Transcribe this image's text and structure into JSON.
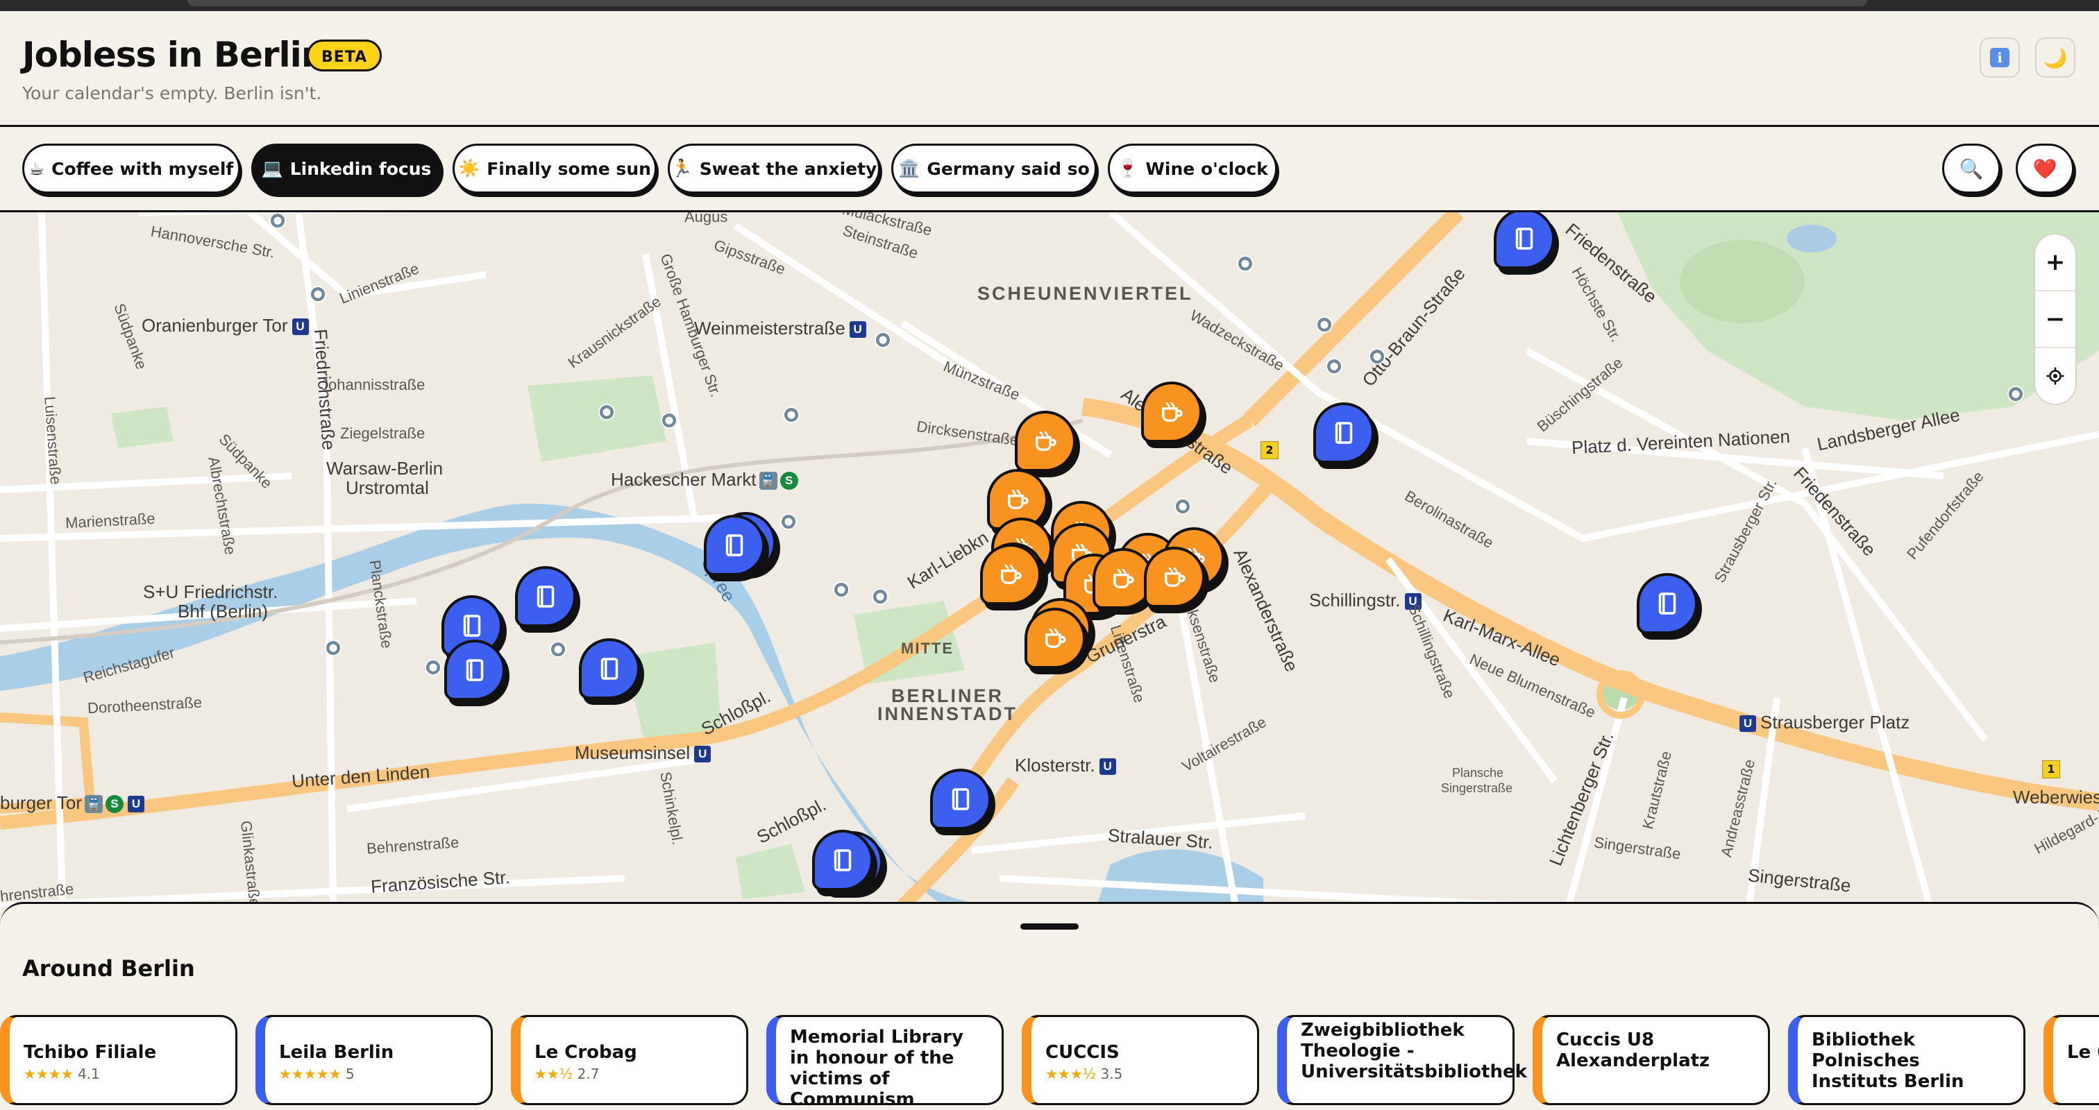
{
  "header": {
    "title": "Jobless in Berlin",
    "badge": "BETA",
    "subtitle": "Your calendar's empty. Berlin isn't.",
    "info_icon": "info-icon",
    "theme_icon": "moon-icon"
  },
  "filters": [
    {
      "icon": "☕",
      "label": "Coffee with myself",
      "active": false
    },
    {
      "icon": "💻",
      "label": "Linkedin focus",
      "active": true
    },
    {
      "icon": "☀️",
      "label": "Finally some sun",
      "active": false
    },
    {
      "icon": "🏃",
      "label": "Sweat the anxiety",
      "active": false
    },
    {
      "icon": "🏛️",
      "label": "Germany said so",
      "active": false
    },
    {
      "icon": "🍷",
      "label": "Wine o'clock",
      "active": false
    }
  ],
  "actions": {
    "search_icon": "search-icon",
    "favorites_icon": "heart-icon"
  },
  "map": {
    "labels": {
      "scheunenviertel": "SCHEUNENVIERTEL",
      "mitte": "MITTE",
      "berliner": "BERLINER",
      "innenstadt": "INNENSTADT",
      "warsaw1": "Warsaw-Berlin",
      "warsaw2": "Urstromtal",
      "oranienburger": "Oranienburger Tor",
      "weinmeister": "Weinmeisterstraße",
      "hackescher": "Hackescher Markt",
      "friedrichbhf1": "S+U Friedrichstr.",
      "friedrichbhf2": "Bhf (Berlin)",
      "museumsinsel": "Museumsinsel",
      "klosterstr": "Klosterstr.",
      "schillingstr": "Schillingstr.",
      "strausberger": "Strausberger Platz",
      "brandenburger": "burger Tor",
      "platz_vn": "Platz d. Vereinten Nationen",
      "landsberger": "Landsberger Allee",
      "unter_den_linden": "Unter den Linden",
      "franzoesische": "Französische Str.",
      "behrenstrasse": "Behrenstraße",
      "stralauer": "Stralauer Str.",
      "singerstrasse1": "Singerstraße",
      "singerstrasse2": "Singerstraße",
      "weberwiese": "Weberwiese",
      "hildegard": "Hildegard-J",
      "johannis": "Johannisstraße",
      "ziegel": "Ziegelstraße",
      "marien": "Marienstraße",
      "dorotheen": "Dorotheenstraße",
      "reichstagufer": "Reichstagufer",
      "hannoversche": "Hannoversche Str.",
      "linien": "Linienstraße",
      "gips": "Gipsstraße",
      "steinstr": "Steinstraße",
      "mulack": "Mulackstraße",
      "augus": "Augus",
      "muenz": "Münzstraße",
      "dircksen": "Dircksenstraße",
      "alexanderstr": "Alexanderstraße",
      "alexanderstr2": "Alexanderstraße",
      "karl_liebkn": "Karl-Liebkn",
      "karl_marx": "Karl-Marx-Allee",
      "otto_braun": "Otto-Braun-Straße",
      "friedenstr": "Friedenstraße",
      "friedenstr2": "Friedenstraße",
      "wadzeck": "Wadzeckstraße",
      "hoechste": "Höchste Str.",
      "buesching": "Büschingstraße",
      "berolina": "Berolinastraße",
      "neue_blumen": "Neue Blumenstraße",
      "schilling_v": "Schillingstraße",
      "lichtenberger": "Lichtenberger Str.",
      "andreas": "Andreasstraße",
      "kraut": "Krautstraße",
      "pufendorf": "Pufendorfstraße",
      "strausberger_str": "Strausberger Str.",
      "plansche": "Plansche",
      "singerstr_small": "Singerstraße",
      "voltaire": "Voltairestraße",
      "littenstr": "Littenstraße",
      "dircksen2": "Dircksenstraße",
      "grunerstr": "Grunerstra",
      "schlosspl1": "Schloßpl.",
      "schlosspl2": "Schloßpl.",
      "spree": "Spree",
      "schinkel": "Schinkelpl.",
      "glinka": "Glinkastraße",
      "planck": "Planckstraße",
      "albrecht": "Albrechtstraße",
      "suedpanke": "Südpanke",
      "suedpanke2": "Südpanke",
      "luisen": "Luisenstraße",
      "friedrichstr": "Friedrichstraße",
      "krausnick": "Krausnickstraße",
      "gr_hamburger": "Große Hamburger Str.",
      "hrenstrasse": "hrenstraße",
      "badge_2": "2",
      "badge_1": "1"
    },
    "controls": {
      "zoom_in": "+",
      "zoom_out": "−",
      "locate_icon": "locate-icon"
    }
  },
  "sheet": {
    "title": "Around Berlin",
    "cards": [
      {
        "name": "Tchibo Filiale",
        "type": "cafe",
        "stars": "★★★★",
        "rating": "4.1"
      },
      {
        "name": "Leila Berlin",
        "type": "lib",
        "stars": "★★★★★",
        "rating": "5"
      },
      {
        "name": "Le Crobag",
        "type": "cafe",
        "stars": "★★½",
        "rating": "2.7"
      },
      {
        "name": "Memorial Library in honour of the victims of Communism",
        "type": "lib",
        "stars": "",
        "rating": ""
      },
      {
        "name": "CUCCIS",
        "type": "cafe",
        "stars": "★★★½",
        "rating": "3.5"
      },
      {
        "name": "Zweigbibliothek Theologie - Universitätsbibliothek",
        "type": "lib",
        "stars": "",
        "rating": ""
      },
      {
        "name": "Cuccis U8 Alexanderplatz",
        "type": "cafe",
        "stars": "",
        "rating": ""
      },
      {
        "name": "Bibliothek Polnisches Instituts Berlin",
        "type": "lib",
        "stars": "",
        "rating": ""
      },
      {
        "name": "Le C",
        "type": "cafe",
        "stars": "",
        "rating": ""
      }
    ]
  },
  "colors": {
    "cafe": "#f7931e",
    "library": "#3d5ff0",
    "accent": "#ffd21a",
    "ink": "#111111"
  }
}
